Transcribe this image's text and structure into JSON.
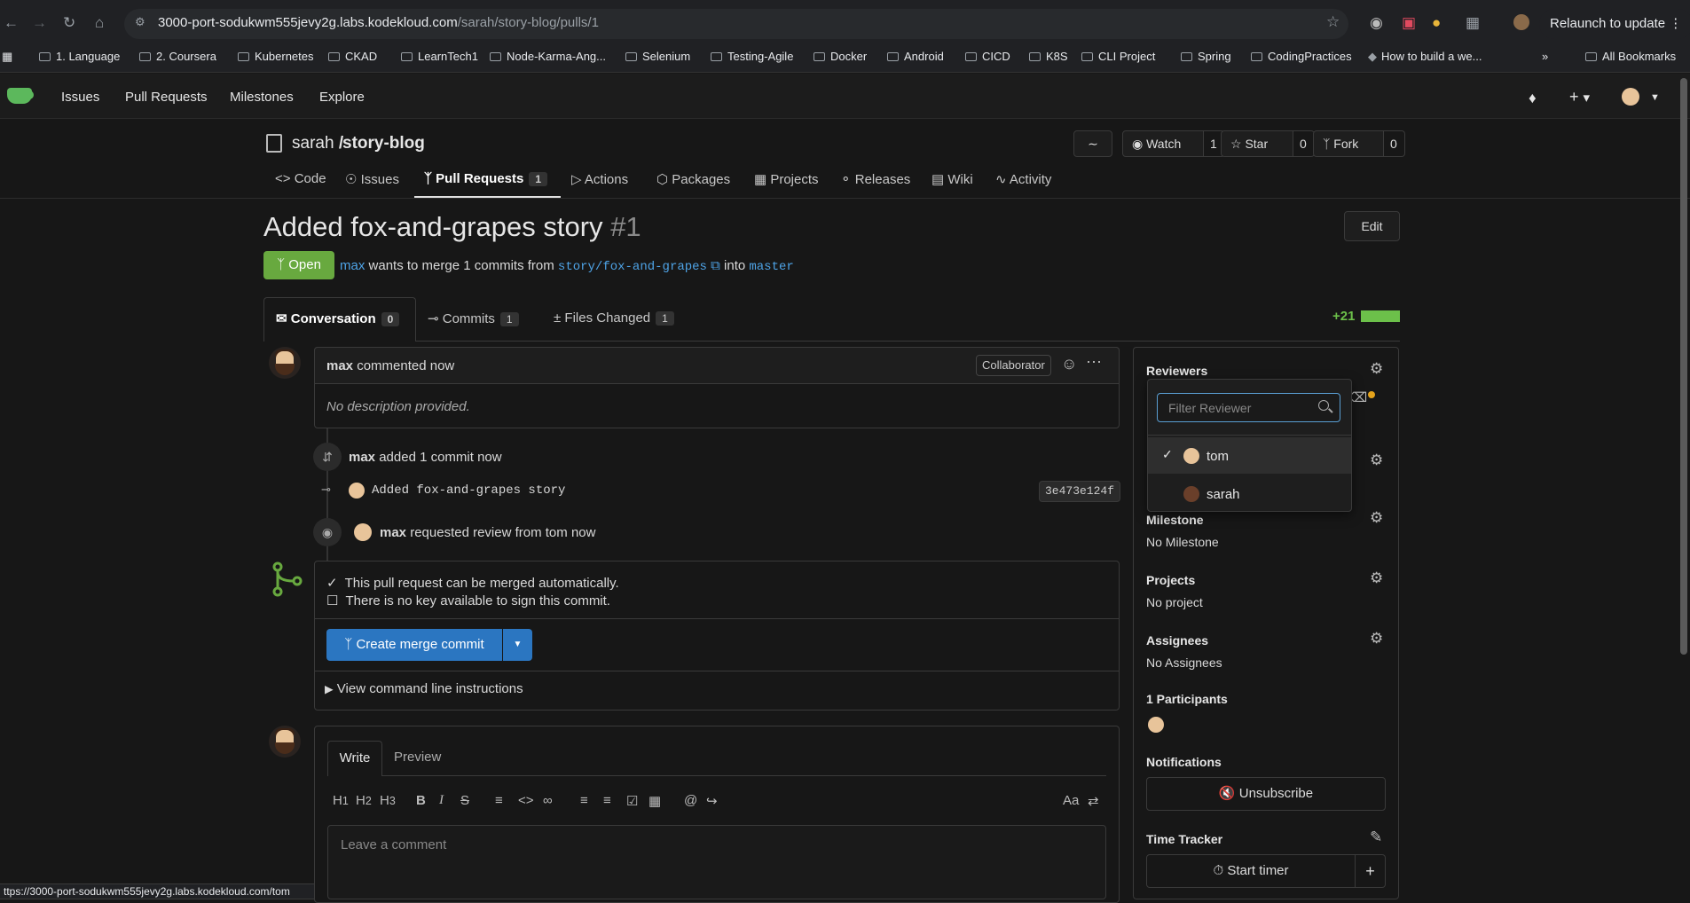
{
  "browser": {
    "url_host": "3000-port-sodukwm555jevy2g.labs.kodekloud.com",
    "url_path": "/sarah/story-blog/pulls/1",
    "relaunch_label": "Relaunch to update",
    "bookmarks": [
      "1. Language",
      "2. Coursera",
      "Kubernetes",
      "CKAD",
      "LearnTech1",
      "Node-Karma-Ang...",
      "Selenium",
      "Testing-Agile",
      "Docker",
      "Android",
      "CICD",
      "K8S",
      "CLI Project",
      "Spring",
      "CodingPractices",
      "How to build a we...",
      "All Bookmarks"
    ],
    "status_url": "ttps://3000-port-sodukwm555jevy2g.labs.kodekloud.com/tom"
  },
  "app_nav": {
    "issues": "Issues",
    "pull_requests": "Pull Requests",
    "milestones": "Milestones",
    "explore": "Explore"
  },
  "repo": {
    "owner": "sarah",
    "separator": "/",
    "name": "story-blog",
    "watch_label": "Watch",
    "watch_count": "1",
    "star_label": "Star",
    "star_count": "0",
    "fork_label": "Fork",
    "fork_count": "0",
    "tabs": {
      "code": "Code",
      "issues": "Issues",
      "pull_requests": "Pull Requests",
      "pr_count": "1",
      "actions": "Actions",
      "packages": "Packages",
      "projects": "Projects",
      "releases": "Releases",
      "wiki": "Wiki",
      "activity": "Activity"
    }
  },
  "pr": {
    "title": "Added fox-and-grapes story",
    "number": "#1",
    "edit_label": "Edit",
    "state": "Open",
    "author": "max",
    "merge_text": "wants to merge 1 commits from",
    "head_branch": "story/fox-and-grapes",
    "into": "into",
    "base_branch": "master",
    "tabs": {
      "conversation": "Conversation",
      "conversation_count": "0",
      "commits": "Commits",
      "commits_count": "1",
      "files": "Files Changed",
      "files_count": "1"
    },
    "diffstat": "+21"
  },
  "comment": {
    "author": "max",
    "action": "commented now",
    "role": "Collaborator",
    "body": "No description provided."
  },
  "timeline": {
    "commit_event_author": "max",
    "commit_event_text": "added 1 commit now",
    "commit_message": "Added fox-and-grapes story",
    "commit_sha": "3e473e124f",
    "review_author": "max",
    "review_text": "requested review from tom now"
  },
  "merge": {
    "line1": "This pull request can be merged automatically.",
    "line2": "There is no key available to sign this commit.",
    "button": "Create merge commit",
    "cli": "View command line instructions"
  },
  "form": {
    "write": "Write",
    "preview": "Preview",
    "placeholder": "Leave a comment",
    "text_size": "Aa"
  },
  "sidebar": {
    "reviewers": "Reviewers",
    "milestone": "Milestone",
    "milestone_value": "No Milestone",
    "projects": "Projects",
    "projects_value": "No project",
    "assignees": "Assignees",
    "assignees_value": "No Assignees",
    "participants": "1 Participants",
    "notifications": "Notifications",
    "unsubscribe": "Unsubscribe",
    "time_tracker": "Time Tracker",
    "start_timer": "Start timer"
  },
  "reviewer_dropdown": {
    "placeholder": "Filter Reviewer",
    "options": [
      {
        "name": "tom",
        "checked": true
      },
      {
        "name": "sarah",
        "checked": false
      }
    ]
  },
  "colors": {
    "accent": "#2b76c1",
    "open": "#68a93f",
    "added": "#6cc04a",
    "link": "#4ea3e6"
  }
}
